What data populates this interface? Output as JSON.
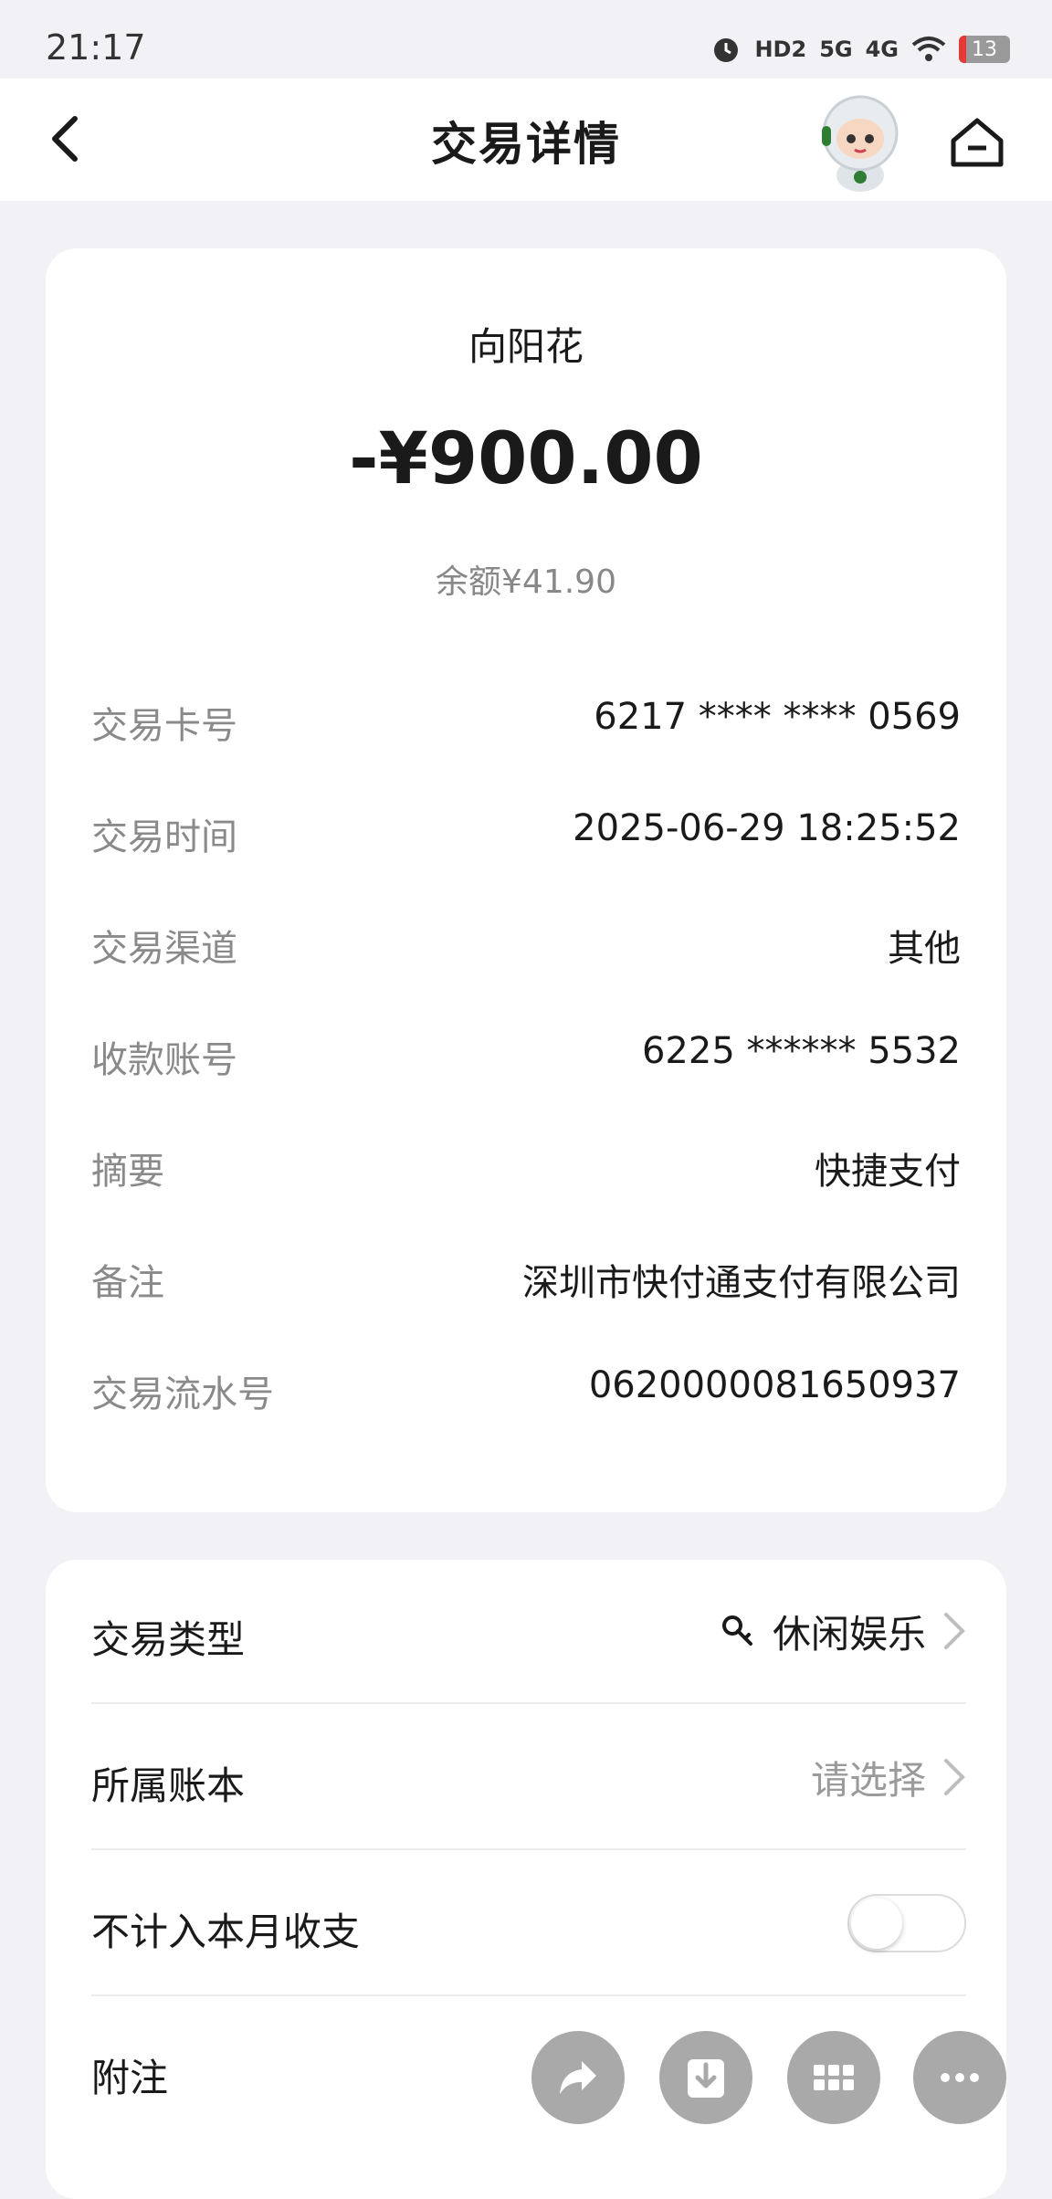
{
  "status_bar": {
    "time": "21:17",
    "indicators": [
      "HD2",
      "5G",
      "4G"
    ],
    "battery": "13"
  },
  "header": {
    "title": "交易详情"
  },
  "transaction": {
    "merchant": "向阳花",
    "amount": "-¥900.00",
    "balance": "余额¥41.90",
    "details": [
      {
        "label": "交易卡号",
        "value": "6217 **** **** 0569"
      },
      {
        "label": "交易时间",
        "value": "2025-06-29 18:25:52"
      },
      {
        "label": "交易渠道",
        "value": "其他"
      },
      {
        "label": "收款账号",
        "value": "6225 ****** 5532"
      },
      {
        "label": "摘要",
        "value": "快捷支付"
      },
      {
        "label": "备注",
        "value": "深圳市快付通支付有限公司"
      },
      {
        "label": "交易流水号",
        "value": "0620000081650937"
      }
    ]
  },
  "options": {
    "type": {
      "label": "交易类型",
      "value": "休闲娱乐"
    },
    "ledger": {
      "label": "所属账本",
      "value": "请选择"
    },
    "exclude": {
      "label": "不计入本月收支",
      "enabled": false
    },
    "note": {
      "label": "附注"
    }
  },
  "actions": [
    "share-icon",
    "download-icon",
    "apps-grid-icon",
    "more-icon"
  ],
  "colors": {
    "background": "#f2f2f6",
    "card": "#ffffff",
    "label_gray": "#8a8a8a",
    "fab_gray": "#a9a9a9"
  }
}
